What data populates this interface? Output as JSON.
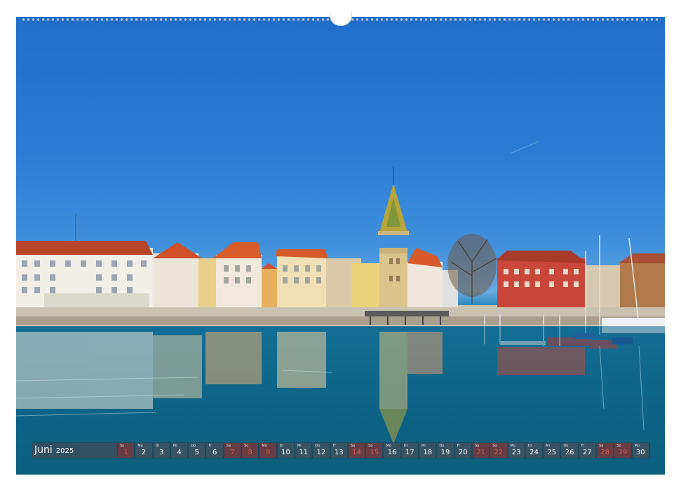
{
  "calendar": {
    "month": "Juni",
    "year": "2025",
    "days": [
      {
        "wd": "So",
        "n": "1",
        "weekend": true
      },
      {
        "wd": "Mo",
        "n": "2",
        "weekend": false
      },
      {
        "wd": "Di",
        "n": "3",
        "weekend": false
      },
      {
        "wd": "Mi",
        "n": "4",
        "weekend": false
      },
      {
        "wd": "Do",
        "n": "5",
        "weekend": false
      },
      {
        "wd": "Fr",
        "n": "6",
        "weekend": false
      },
      {
        "wd": "Sa",
        "n": "7",
        "weekend": true
      },
      {
        "wd": "So",
        "n": "8",
        "weekend": true
      },
      {
        "wd": "Mo",
        "n": "9",
        "weekend": true
      },
      {
        "wd": "Di",
        "n": "10",
        "weekend": false
      },
      {
        "wd": "Mi",
        "n": "11",
        "weekend": false
      },
      {
        "wd": "Do",
        "n": "12",
        "weekend": false
      },
      {
        "wd": "Fr",
        "n": "13",
        "weekend": false
      },
      {
        "wd": "Sa",
        "n": "14",
        "weekend": true
      },
      {
        "wd": "So",
        "n": "15",
        "weekend": true
      },
      {
        "wd": "Mo",
        "n": "16",
        "weekend": false
      },
      {
        "wd": "Di",
        "n": "17",
        "weekend": false
      },
      {
        "wd": "Mi",
        "n": "18",
        "weekend": false
      },
      {
        "wd": "Do",
        "n": "19",
        "weekend": false
      },
      {
        "wd": "Fr",
        "n": "20",
        "weekend": false
      },
      {
        "wd": "Sa",
        "n": "21",
        "weekend": true
      },
      {
        "wd": "So",
        "n": "22",
        "weekend": true
      },
      {
        "wd": "Mo",
        "n": "23",
        "weekend": false
      },
      {
        "wd": "Di",
        "n": "24",
        "weekend": false
      },
      {
        "wd": "Mi",
        "n": "25",
        "weekend": false
      },
      {
        "wd": "Do",
        "n": "26",
        "weekend": false
      },
      {
        "wd": "Fr",
        "n": "27",
        "weekend": false
      },
      {
        "wd": "Sa",
        "n": "28",
        "weekend": true
      },
      {
        "wd": "So",
        "n": "29",
        "weekend": true
      },
      {
        "wd": "Mo",
        "n": "30",
        "weekend": false
      }
    ]
  },
  "colors": {
    "sky": "#2a7dd4",
    "water": "#0f6a8e",
    "weekend_text": "#d75a50",
    "calendar_bar": "#3a4a58"
  },
  "photo": {
    "subject": "harbour-waterfront-image"
  }
}
